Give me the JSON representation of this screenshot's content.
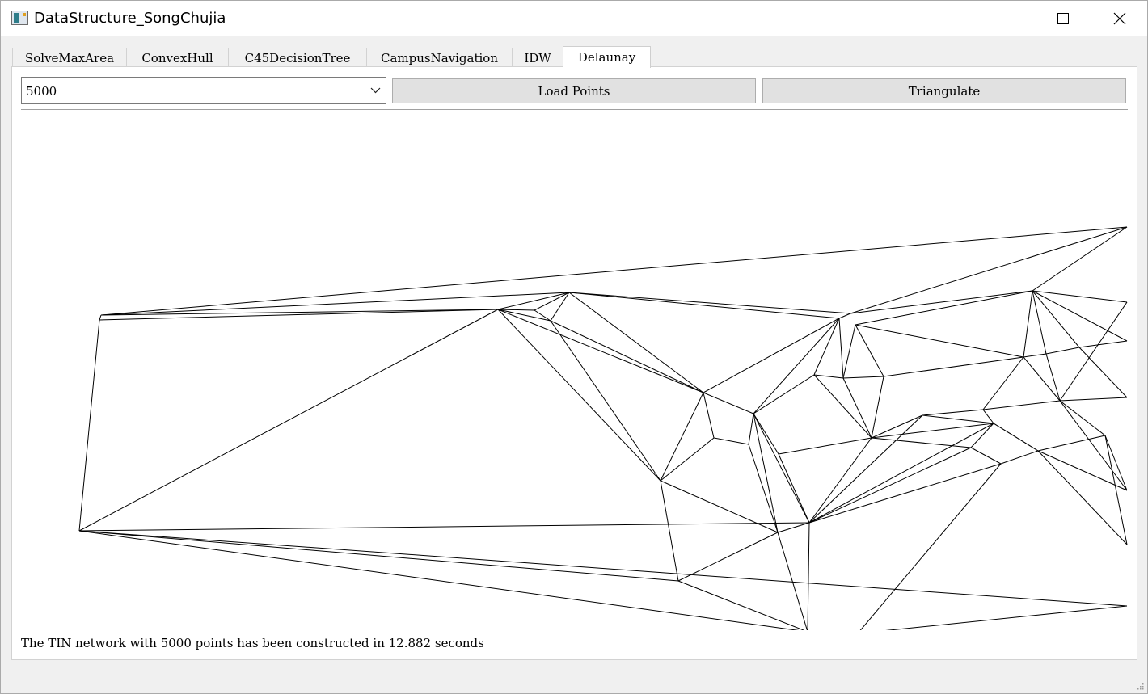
{
  "window": {
    "title": "DataStructure_SongChujia",
    "icon": "app-window-icon",
    "controls": [
      "minimize-icon",
      "maximize-icon",
      "close-icon"
    ]
  },
  "tabs": [
    {
      "label": "SolveMaxArea",
      "active": false
    },
    {
      "label": "ConvexHull",
      "active": false
    },
    {
      "label": "C45DecisionTree",
      "active": false
    },
    {
      "label": "CampusNavigation",
      "active": false
    },
    {
      "label": "IDW",
      "active": false
    },
    {
      "label": "Delaunay",
      "active": true
    }
  ],
  "toolbar": {
    "point_count_selected": "5000",
    "load_label": "Load Points",
    "triangulate_label": "Triangulate"
  },
  "canvas": {
    "content": "Delaunay triangulation (TIN) wireframe",
    "stroke_color": "#000000",
    "background_color": "#ffffff"
  },
  "status": {
    "message": "The TIN network with 5000 points has been constructed in 12.882 seconds"
  }
}
